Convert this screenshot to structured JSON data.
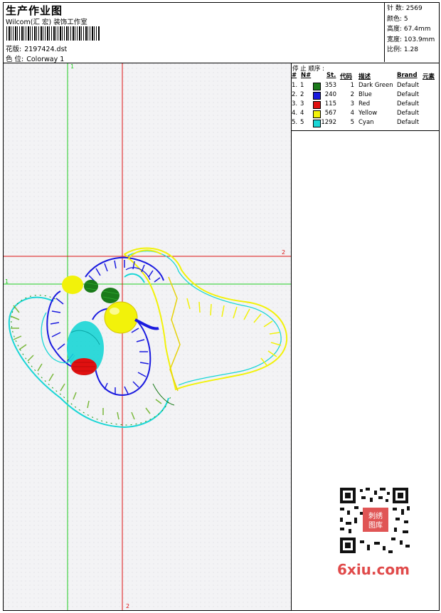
{
  "header": {
    "title": "生产作业图",
    "studio": "Wilcom(汇 宏) 装饰工作室",
    "design_label": "花版:",
    "design_value": "2197424.dst",
    "colorway_label": "色 位:",
    "colorway_value": "Colorway 1"
  },
  "stats": [
    {
      "label": "针 数:",
      "value": "2569"
    },
    {
      "label": "颜色:",
      "value": "5"
    },
    {
      "label": "高度:",
      "value": "67.4mm"
    },
    {
      "label": "宽度:",
      "value": "103.9mm"
    },
    {
      "label": "比例:",
      "value": "1.28"
    }
  ],
  "legend": {
    "title": "停 止 顺序 :",
    "headers": [
      "#",
      "N#",
      "St.",
      "代码",
      "描述",
      "Brand",
      "元素"
    ],
    "rows": [
      {
        "idx": "1.",
        "n": "1",
        "st": "353",
        "code": "1",
        "desc": "Dark Green",
        "brand": "Default",
        "color": "#1a7a1a"
      },
      {
        "idx": "2.",
        "n": "2",
        "st": "240",
        "code": "2",
        "desc": "Blue",
        "brand": "Default",
        "color": "#1a1adf"
      },
      {
        "idx": "3.",
        "n": "3",
        "st": "115",
        "code": "3",
        "desc": "Red",
        "brand": "Default",
        "color": "#e01010"
      },
      {
        "idx": "4.",
        "n": "4",
        "st": "567",
        "code": "4",
        "desc": "Yellow",
        "brand": "Default",
        "color": "#f2f20a"
      },
      {
        "idx": "5.",
        "n": "5",
        "st": "1292",
        "code": "5",
        "desc": "Cyan",
        "brand": "Default",
        "color": "#1ad6d6"
      }
    ]
  },
  "guides": {
    "green_top": "1",
    "green_left": "1",
    "red_right": "2",
    "red_bottom": "2"
  },
  "colors": {
    "guide_green": "#22cc22",
    "guide_red": "#dd1111",
    "watermark": "#e04a4a"
  },
  "watermark": {
    "site": "6xiu.com",
    "seal": "刺绣 图库"
  }
}
